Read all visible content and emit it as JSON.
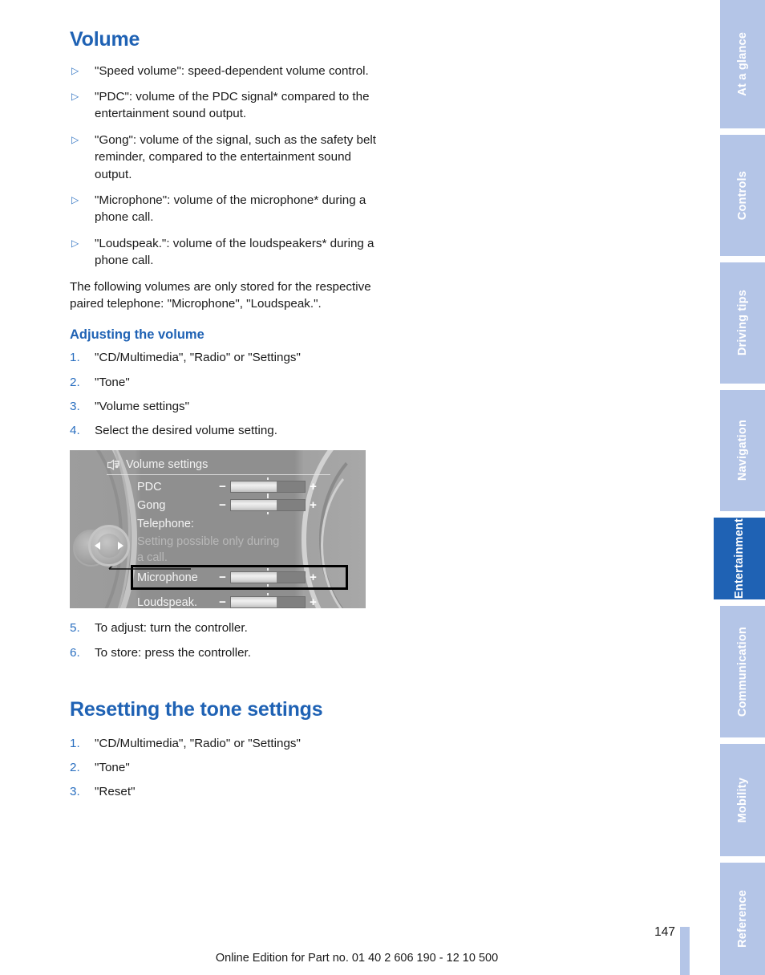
{
  "document": {
    "section_title": "Volume",
    "bullets": [
      "\"Speed volume\": speed-dependent volume control.",
      "\"PDC\": volume of the PDC signal* compared to the entertainment sound output.",
      "\"Gong\": volume of the signal, such as the safety belt reminder, compared to the entertainment sound output.",
      "\"Microphone\": volume of the microphone* during a phone call.",
      "\"Loudspeak.\": volume of the loudspeakers* during a phone call."
    ],
    "paragraph": "The following volumes are only stored for the respective paired telephone: \"Microphone\", \"Loudspeak.\".",
    "adjusting": {
      "heading": "Adjusting the volume",
      "steps_before_figure": [
        "\"CD/Multimedia\", \"Radio\" or \"Settings\"",
        "\"Tone\"",
        "\"Volume settings\"",
        "Select the desired volume setting."
      ],
      "steps_after_figure": [
        "To adjust: turn the controller.",
        "To store: press the controller."
      ],
      "step_numbers_before": [
        "1.",
        "2.",
        "3.",
        "4."
      ],
      "step_numbers_after": [
        "5.",
        "6."
      ]
    },
    "resetting": {
      "heading": "Resetting the tone settings",
      "steps": [
        "\"CD/Multimedia\", \"Radio\" or \"Settings\"",
        "\"Tone\"",
        "\"Reset\""
      ],
      "step_numbers": [
        "1.",
        "2.",
        "3."
      ]
    },
    "bullet_glyph": "▷"
  },
  "figure": {
    "title": "Volume settings",
    "icon": "tone-speaker-icon",
    "rows": [
      {
        "label": "PDC",
        "minus": "−",
        "plus": "+",
        "value_percent": 62
      },
      {
        "label": "Gong",
        "minus": "−",
        "plus": "+",
        "value_percent": 62
      }
    ],
    "telephone_label": "Telephone:",
    "telephone_note_line1": "Setting possible only during",
    "telephone_note_line2": "a call.",
    "phone_rows": [
      {
        "label": "Microphone",
        "minus": "−",
        "plus": "+",
        "value_percent": 62,
        "highlighted": true
      },
      {
        "label": "Loudspeak.",
        "minus": "−",
        "plus": "+",
        "value_percent": 62,
        "highlighted": false
      }
    ],
    "controller": "controller-knob"
  },
  "footer": {
    "edition": "Online Edition for Part no. 01 40 2 606 190 - 12 10 500",
    "page_number": "147"
  },
  "tabs": [
    {
      "label": "At a glance",
      "active": false
    },
    {
      "label": "Controls",
      "active": false
    },
    {
      "label": "Driving tips",
      "active": false
    },
    {
      "label": "Navigation",
      "active": false
    },
    {
      "label": "Entertainment",
      "active": true
    },
    {
      "label": "Communication",
      "active": false
    },
    {
      "label": "Mobility",
      "active": false
    },
    {
      "label": "Reference",
      "active": false
    }
  ],
  "colors": {
    "accent_blue": "#1f62b4",
    "tab_inactive": "#b4c5e7",
    "page_bar": "#b4c5e7"
  }
}
